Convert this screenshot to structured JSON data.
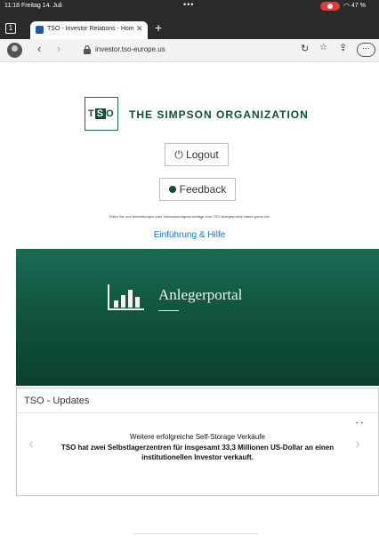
{
  "status_bar": {
    "time": "11:18  Freitag 14. Juli",
    "dots": "•••",
    "battery": "47 %"
  },
  "tabs": {
    "count": "1",
    "active_title": "TSO - Investor Relations - Hom"
  },
  "toolbar": {
    "url": "investor.tso-europe.us"
  },
  "page": {
    "logo_mark_left": "T",
    "logo_mark_mid": "S",
    "logo_mark_right": "O",
    "org_name": "THE SIMPSON ORGANIZATION",
    "logout_label": "Logout",
    "feedback_label": "Feedback",
    "feedback_hint": "Teilen Sie uns Anmerkungen oder Verbesserungsvorschläge zum TSO-Anlegerportal haben gerne mit.",
    "help_link": "Einführung & Hilfe",
    "hero_title": "Anlegerportal"
  },
  "updates": {
    "title": "TSO - Updates",
    "headline": "Weitere erfolgreiche Self-Storage Verkäufe",
    "body": "TSO hat zwei Selbstlagerzentren für insgesamt 33,3 Millionen US-Dollar an einen institutionellen Investor verkauft."
  },
  "colors": {
    "brand_green": "#0f4d3a",
    "link_blue": "#1a73c7"
  }
}
